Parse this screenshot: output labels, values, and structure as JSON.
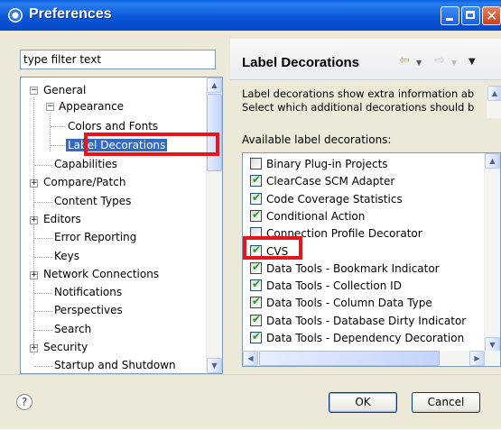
{
  "window": {
    "title": "Preferences"
  },
  "filter": {
    "placeholder": "type filter text"
  },
  "tree": {
    "general": "General",
    "appearance": "Appearance",
    "colors_fonts": "Colors and Fonts",
    "label_decorations": "Label Decorations",
    "items": [
      {
        "label": "Capabilities",
        "expandable": false
      },
      {
        "label": "Compare/Patch",
        "expandable": true
      },
      {
        "label": "Content Types",
        "expandable": false
      },
      {
        "label": "Editors",
        "expandable": true
      },
      {
        "label": "Error Reporting",
        "expandable": false
      },
      {
        "label": "Keys",
        "expandable": false
      },
      {
        "label": "Network Connections",
        "expandable": true
      },
      {
        "label": "Notifications",
        "expandable": false
      },
      {
        "label": "Perspectives",
        "expandable": false
      },
      {
        "label": "Search",
        "expandable": false
      },
      {
        "label": "Security",
        "expandable": true
      },
      {
        "label": "Startup and Shutdown",
        "expandable": false
      }
    ]
  },
  "panel": {
    "title": "Label Decorations",
    "description_line1": "Label decorations show extra information ab",
    "description_line2": "Select which additional decorations should b",
    "available_label": "Available label decorations:",
    "decorations": [
      {
        "label": "Binary Plug-in Projects",
        "checked": false
      },
      {
        "label": "ClearCase SCM Adapter",
        "checked": true
      },
      {
        "label": "Code Coverage Statistics",
        "checked": true
      },
      {
        "label": "Conditional Action",
        "checked": true
      },
      {
        "label": "Connection Profile Decorator",
        "checked": false
      },
      {
        "label": "CVS",
        "checked": true
      },
      {
        "label": "Data Tools - Bookmark Indicator",
        "checked": true
      },
      {
        "label": "Data Tools - Collection ID",
        "checked": true
      },
      {
        "label": "Data Tools - Column Data Type",
        "checked": true
      },
      {
        "label": "Data Tools - Database Dirty Indicator",
        "checked": true
      },
      {
        "label": "Data Tools - Dependency Decoration",
        "checked": true
      }
    ]
  },
  "buttons": {
    "ok": "OK",
    "cancel": "Cancel",
    "help": "?"
  },
  "colors": {
    "highlight": "#e8141c",
    "selection": "#316ac5",
    "check": "#21a121"
  }
}
